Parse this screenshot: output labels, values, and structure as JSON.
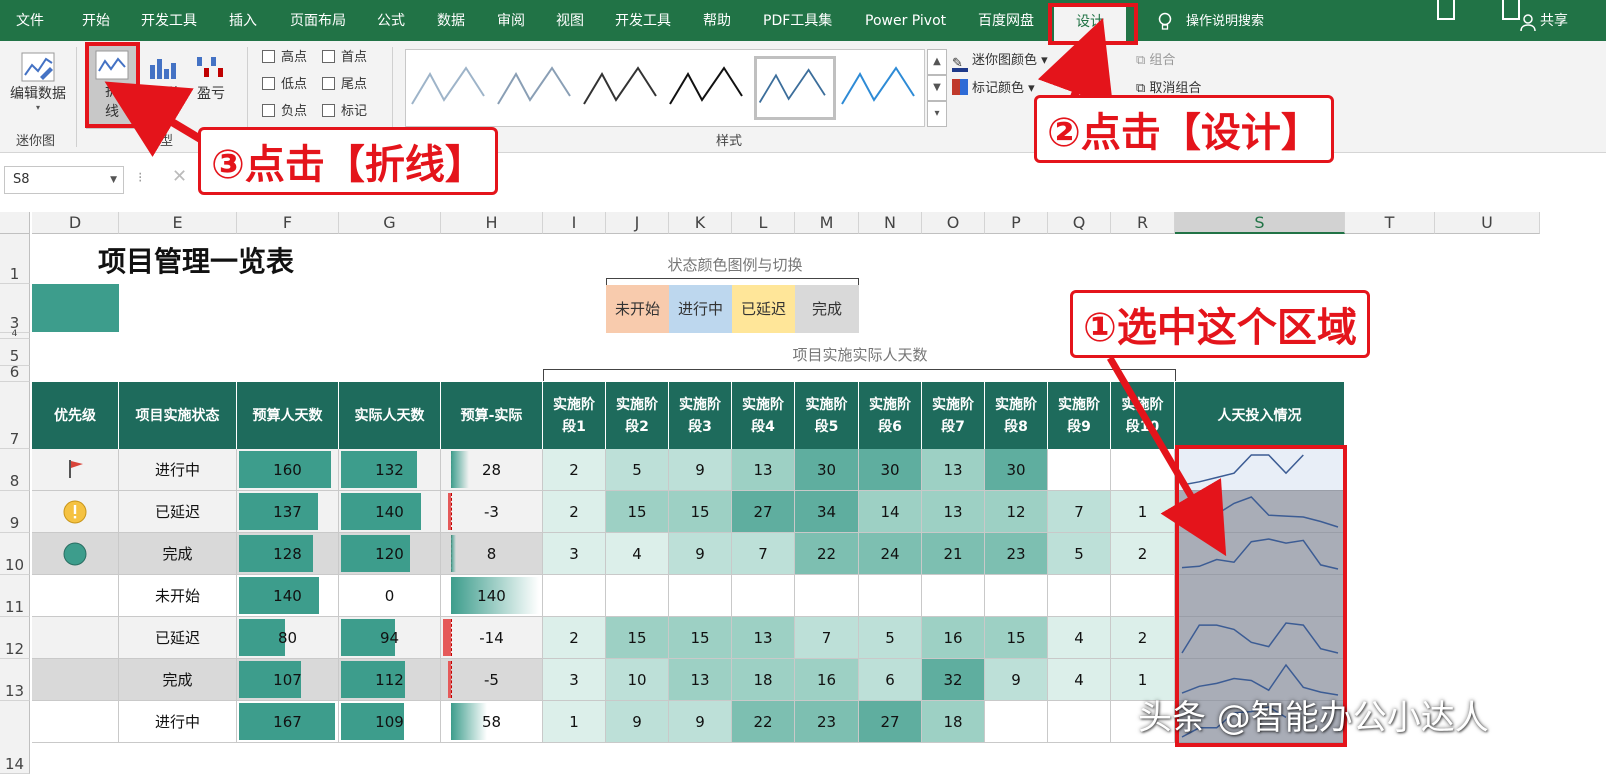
{
  "menu": {
    "items": [
      "文件",
      "开始",
      "开发工具",
      "插入",
      "页面布局",
      "公式",
      "数据",
      "审阅",
      "视图",
      "开发工具",
      "帮助",
      "PDF工具集",
      "Power Pivot",
      "百度网盘"
    ],
    "active": "设计",
    "search": "操作说明搜索",
    "share": "共享"
  },
  "ribbon": {
    "edit_data": "编辑数据",
    "group_sparkline": "迷你图",
    "line_label_1": "折",
    "line_label_2": "线",
    "column_label": "柱形",
    "winloss_label": "盈亏",
    "group_type": "类型",
    "checks": [
      "高点",
      "首点",
      "低点",
      "尾点",
      "负点",
      "标记"
    ],
    "group_style": "样式",
    "sparkline_color": "迷你图颜色",
    "marker_color": "标记颜色",
    "group_btn": "组合",
    "ungroup_btn": "取消组合"
  },
  "formula": {
    "namebox": "S8"
  },
  "columns": [
    "D",
    "E",
    "F",
    "G",
    "H",
    "I",
    "J",
    "K",
    "L",
    "M",
    "N",
    "O",
    "P",
    "Q",
    "R",
    "S",
    "T",
    "U"
  ],
  "rows": [
    "1",
    "3",
    "4",
    "5",
    "6",
    "7",
    "8",
    "9",
    "10",
    "11",
    "12",
    "13",
    "14"
  ],
  "sheet": {
    "title": "项目管理一览表",
    "legend_caption": "状态颜色图例与切换",
    "legend": [
      {
        "label": "未开始",
        "color": "#f8cbad"
      },
      {
        "label": "进行中",
        "color": "#bdd7ee"
      },
      {
        "label": "已延迟",
        "color": "#ffe699"
      },
      {
        "label": "完成",
        "color": "#d9d9d9"
      }
    ],
    "sub_caption": "项目实施实际人天数",
    "headers": [
      "优先级",
      "项目实施状态",
      "预算人天数",
      "实际人天数",
      "预算-实际",
      "实施阶\n段1",
      "实施阶\n段2",
      "实施阶\n段3",
      "实施阶\n段4",
      "实施阶\n段5",
      "实施阶\n段6",
      "实施阶\n段7",
      "实施阶\n段8",
      "实施阶\n段9",
      "实施阶\n段10",
      "人天投入情况"
    ],
    "rows": [
      {
        "icon": "flag",
        "status": "进行中",
        "budget": "160",
        "actual": "132",
        "diff": "28",
        "stages": [
          "2",
          "5",
          "9",
          "13",
          "30",
          "30",
          "13",
          "30",
          "",
          ""
        ]
      },
      {
        "icon": "warning",
        "status": "已延迟",
        "budget": "137",
        "actual": "140",
        "diff": "-3",
        "stages": [
          "2",
          "15",
          "15",
          "27",
          "34",
          "14",
          "13",
          "12",
          "7",
          "1"
        ]
      },
      {
        "icon": "circle",
        "status": "完成",
        "budget": "128",
        "actual": "120",
        "diff": "8",
        "stages": [
          "3",
          "4",
          "9",
          "7",
          "22",
          "24",
          "21",
          "23",
          "5",
          "2"
        ]
      },
      {
        "icon": "",
        "status": "未开始",
        "budget": "140",
        "actual": "0",
        "diff": "140",
        "stages": [
          "",
          "",
          "",
          "",
          "",
          "",
          "",
          "",
          "",
          ""
        ]
      },
      {
        "icon": "",
        "status": "已延迟",
        "budget": "80",
        "actual": "94",
        "diff": "-14",
        "stages": [
          "2",
          "15",
          "15",
          "13",
          "7",
          "5",
          "16",
          "15",
          "4",
          "2"
        ]
      },
      {
        "icon": "",
        "status": "完成",
        "budget": "107",
        "actual": "112",
        "diff": "-5",
        "stages": [
          "3",
          "10",
          "13",
          "18",
          "16",
          "6",
          "32",
          "9",
          "4",
          "1"
        ]
      },
      {
        "icon": "",
        "status": "进行中",
        "budget": "167",
        "actual": "109",
        "diff": "58",
        "stages": [
          "1",
          "9",
          "9",
          "22",
          "23",
          "27",
          "18",
          "",
          "",
          ""
        ]
      }
    ]
  },
  "annotations": {
    "step1": "①选中这个区域",
    "step2": "②点击【设计】",
    "step3": "③点击【折线】",
    "watermark": "头条 @智能办公小达人"
  },
  "colors": {
    "excel_green": "#217346",
    "header_teal": "#1e6b5c",
    "bar_teal": "#3d9d8c",
    "annotation_red": "#e4141b"
  }
}
